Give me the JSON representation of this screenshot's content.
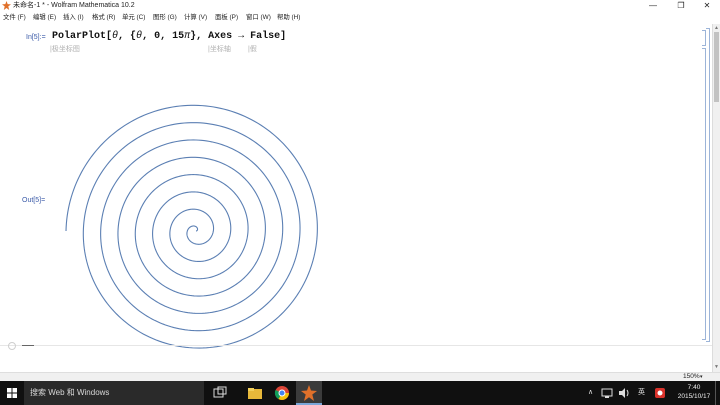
{
  "window": {
    "title": "未命名-1 * - Wolfram Mathematica 10.2",
    "minimize_icon": "—",
    "maximize_icon": "❐",
    "close_icon": "✕"
  },
  "menu": {
    "items": [
      "文件 (F)",
      "编辑 (E)",
      "插入 (I)",
      "格式 (R)",
      "单元 (C)",
      "图形 (G)",
      "计算 (V)",
      "面板 (P)",
      "窗口 (W)",
      "帮助 (H)"
    ]
  },
  "notebook": {
    "in_label": "In[5]:=",
    "out_label": "Out[5]=",
    "code": {
      "fn": "PolarPlot[",
      "var1": "θ",
      "mid": ", {",
      "var2": "θ",
      "range": ", 0, 15",
      "pi": "π",
      "rest": "}, Axes → False]"
    },
    "hint_polarplot": "|极坐标图",
    "hint_axes": "|坐标轴",
    "hint_false": "|假"
  },
  "plot": {
    "type": "polar-spiral",
    "function": "r = θ",
    "theta_min": 0,
    "theta_max_pi_multiple": 15,
    "color": "#5b7fb3"
  },
  "status": {
    "zoom": "150%",
    "zoom_arrow": "▾"
  },
  "taskbar": {
    "search_placeholder": "搜索 Web 和 Windows",
    "tray_lang": "英",
    "tray_arrow": "∧",
    "time": "7:40",
    "date": "2015/10/17"
  }
}
